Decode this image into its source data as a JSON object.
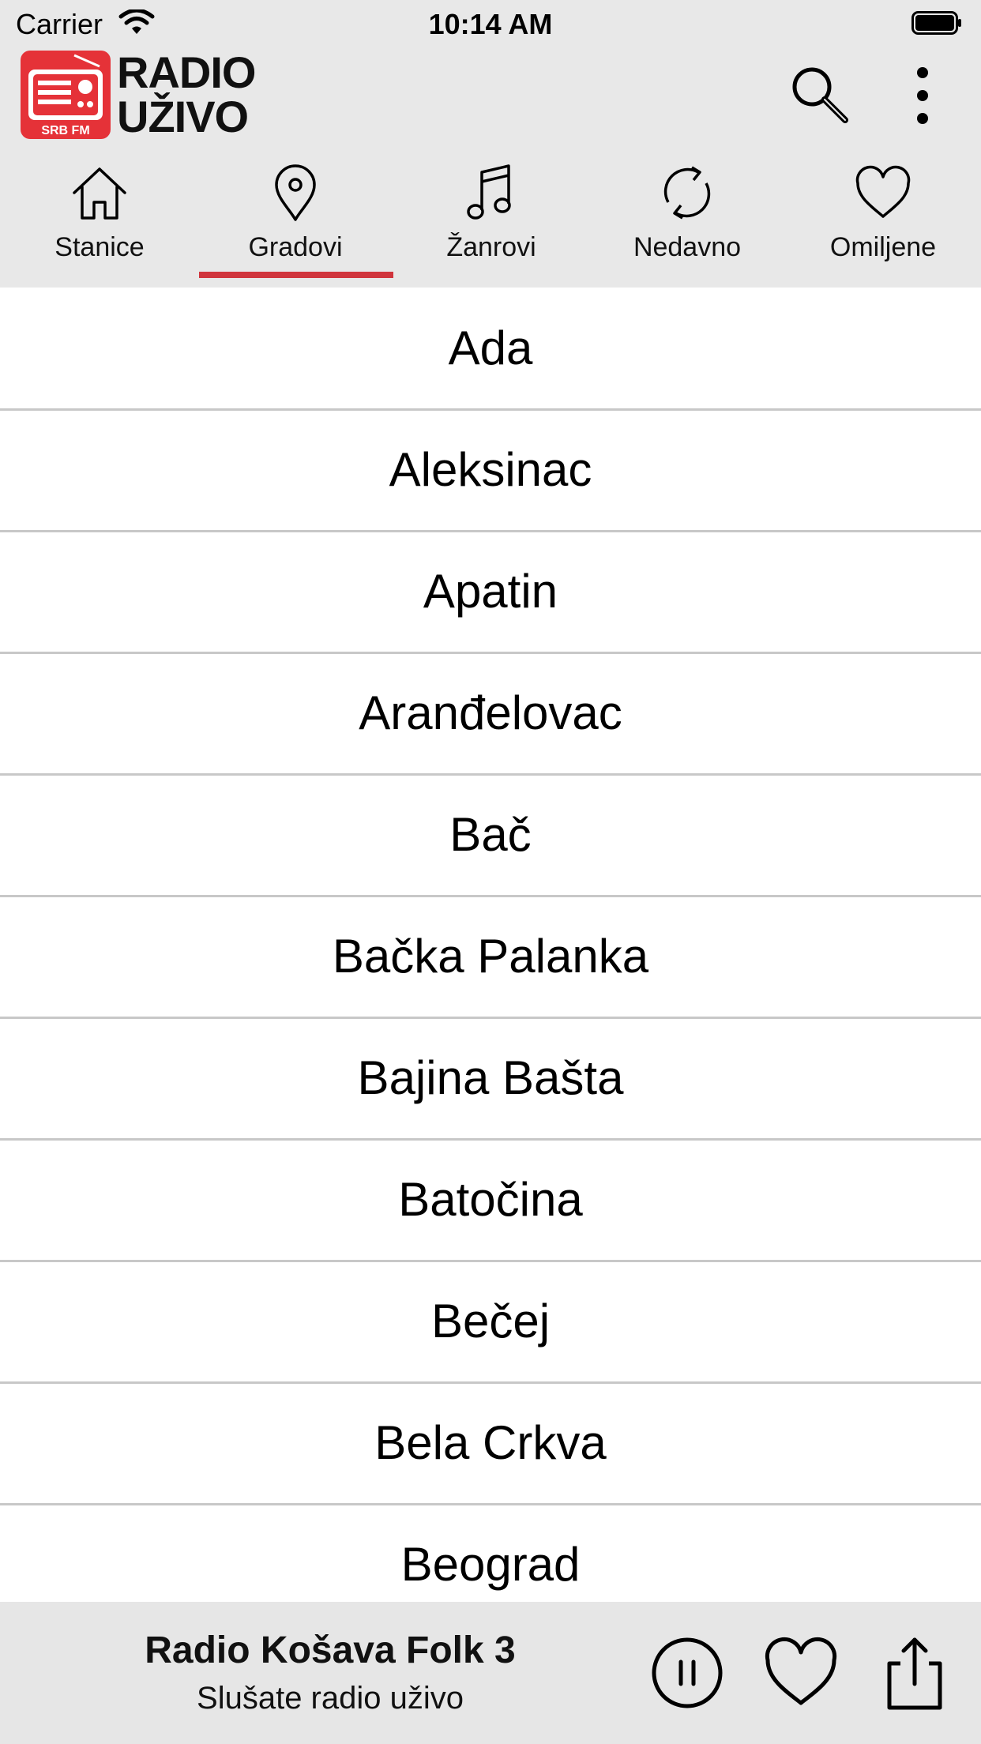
{
  "status_bar": {
    "carrier": "Carrier",
    "time": "10:14 AM"
  },
  "app": {
    "brand_line1": "RADIO",
    "brand_line2": "UŽIVO",
    "logo_text": "SRB FM",
    "accent_color": "#d0343c"
  },
  "tabs": [
    {
      "label": "Stanice",
      "icon": "home-icon",
      "selected": false
    },
    {
      "label": "Gradovi",
      "icon": "location-pin-icon",
      "selected": true
    },
    {
      "label": "Žanrovi",
      "icon": "music-note-icon",
      "selected": false
    },
    {
      "label": "Nedavno",
      "icon": "refresh-icon",
      "selected": false
    },
    {
      "label": "Omiljene",
      "icon": "heart-icon",
      "selected": false
    }
  ],
  "cities": [
    "Ada",
    "Aleksinac",
    "Apatin",
    "Aranđelovac",
    "Bač",
    "Bačka Palanka",
    "Bajina Bašta",
    "Batočina",
    "Bečej",
    "Bela Crkva",
    "Beograd"
  ],
  "player": {
    "station": "Radio Košava Folk 3",
    "subtitle": "Slušate radio uživo",
    "state": "playing"
  }
}
